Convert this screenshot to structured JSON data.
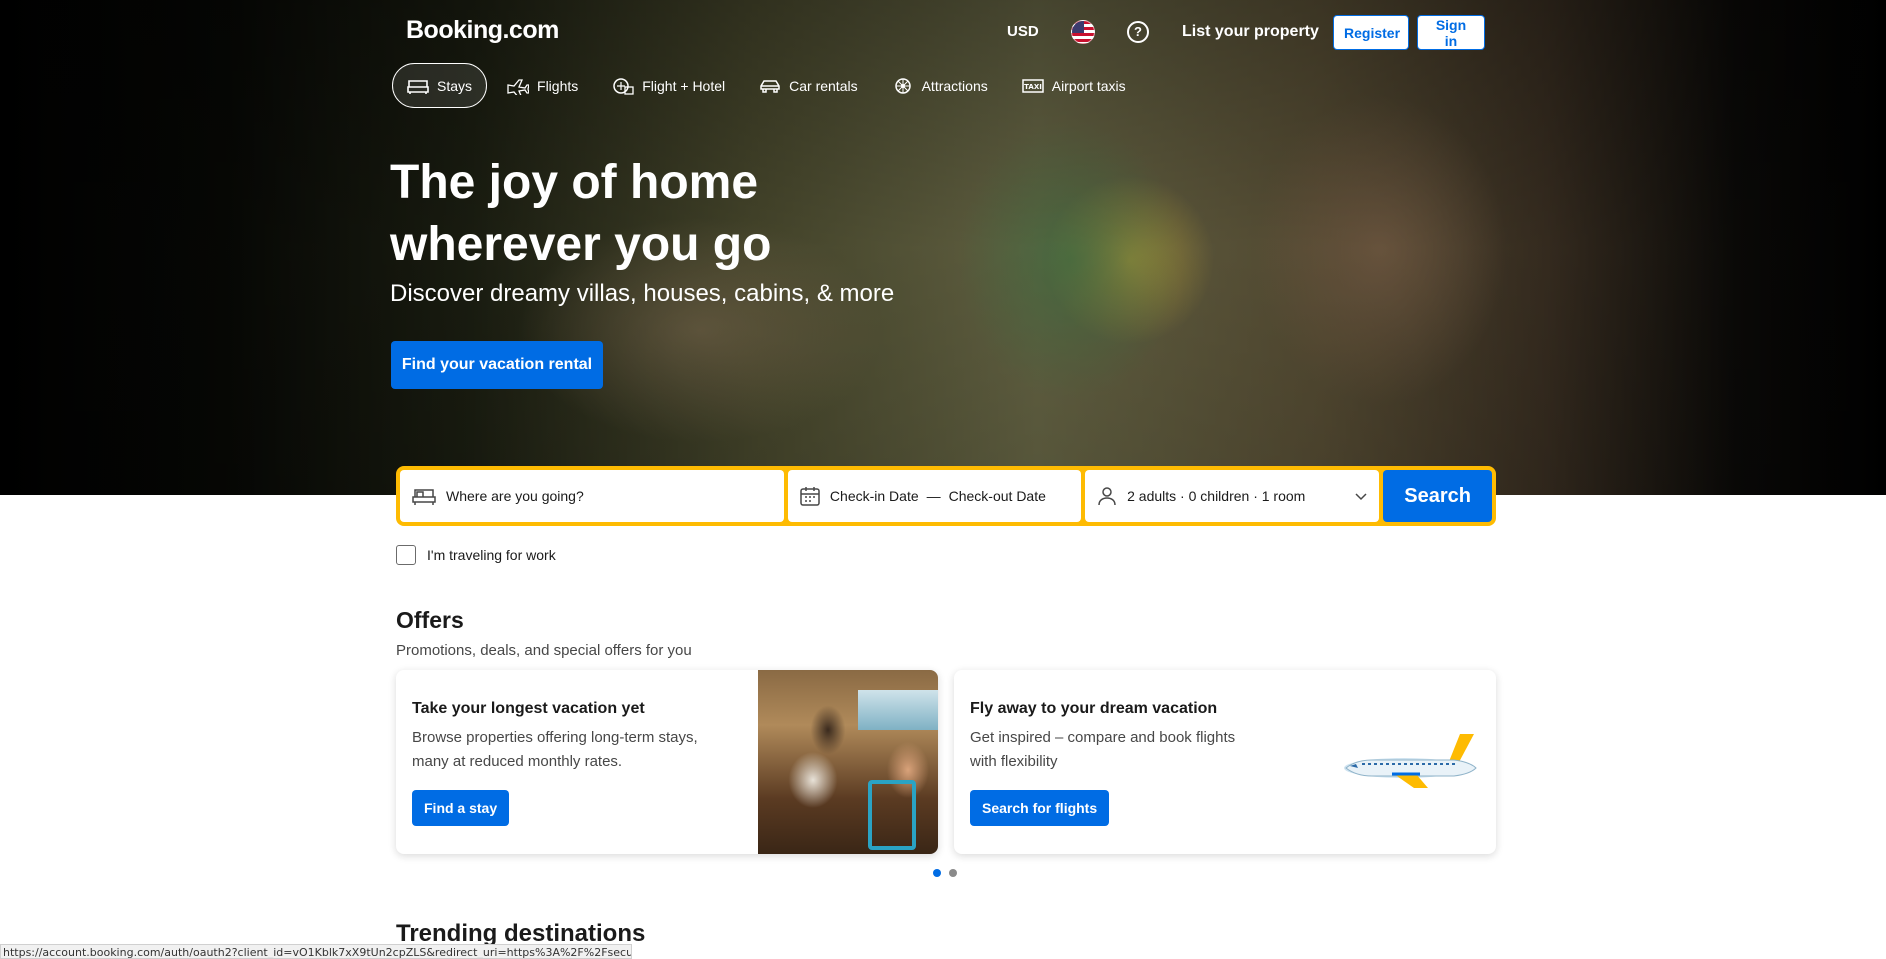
{
  "header": {
    "logo": "Booking.com",
    "currency": "USD",
    "help": "?",
    "list_property": "List your property",
    "register": "Register",
    "sign_in": "Sign in"
  },
  "nav": {
    "items": [
      {
        "label": "Stays",
        "icon": "bed-icon",
        "active": true
      },
      {
        "label": "Flights",
        "icon": "plane-icon"
      },
      {
        "label": "Flight + Hotel",
        "icon": "flight-hotel-icon"
      },
      {
        "label": "Car rentals",
        "icon": "car-icon"
      },
      {
        "label": "Attractions",
        "icon": "attractions-icon"
      },
      {
        "label": "Airport taxis",
        "icon": "taxi-icon"
      }
    ]
  },
  "hero": {
    "title_line1": "The joy of home",
    "title_line2": "wherever you go",
    "subtitle": "Discover dreamy villas, houses, cabins, & more",
    "cta": "Find your vacation rental"
  },
  "search": {
    "destination_placeholder": "Where are you going?",
    "checkin": "Check-in Date",
    "dash": "—",
    "checkout": "Check-out Date",
    "guests": "2 adults · 0 children · 1 room",
    "button": "Search",
    "work_label": "I'm traveling for work"
  },
  "offers": {
    "title": "Offers",
    "subtitle": "Promotions, deals, and special offers for you",
    "cards": [
      {
        "title": "Take your longest vacation yet",
        "text": "Browse properties offering long-term stays, many at reduced monthly rates.",
        "button": "Find a stay"
      },
      {
        "title": "Fly away to your dream vacation",
        "text": "Get inspired – compare and book flights with flexibility",
        "button": "Search for flights"
      }
    ]
  },
  "trending": {
    "title": "Trending destinations"
  },
  "status_bar": "https://account.booking.com/auth/oauth2?client_id=vO1Kblk7xX9tUn2cpZLS&redirect_uri=https%3A%2F%2Fsecure...",
  "colors": {
    "brand_blue": "#006ce4",
    "search_yellow": "#febb02"
  }
}
